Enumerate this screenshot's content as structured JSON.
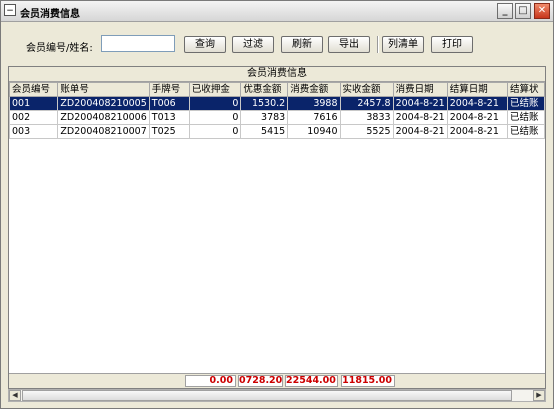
{
  "window": {
    "title": "会员消费信息",
    "system_icon": "−",
    "minimize": "_",
    "maximize": "□",
    "close": "✕"
  },
  "toolbar": {
    "search_label": "会员编号/姓名:",
    "search_value": "",
    "buttons": [
      "查询",
      "过滤",
      "刷新",
      "导出",
      "列清单",
      "打印"
    ]
  },
  "grid": {
    "title": "会员消费信息",
    "columns": [
      "会员编号",
      "账单号",
      "手牌号",
      "已收押金",
      "优惠金额",
      "消费金额",
      "实收金额",
      "消费日期",
      "结算日期",
      "结算状"
    ],
    "rows": [
      [
        "001",
        "ZD200408210005",
        "T006",
        "0",
        "1530.2",
        "3988",
        "2457.8",
        "2004-8-21",
        "2004-8-21",
        "已结账"
      ],
      [
        "002",
        "ZD200408210006",
        "T013",
        "0",
        "3783",
        "7616",
        "3833",
        "2004-8-21",
        "2004-8-21",
        "已结账"
      ],
      [
        "003",
        "ZD200408210007",
        "T025",
        "0",
        "5415",
        "10940",
        "5525",
        "2004-8-21",
        "2004-8-21",
        "已结账"
      ]
    ],
    "selected_row": 0,
    "totals": [
      "0.00",
      "0728.20",
      "22544.00",
      "11815.00"
    ]
  },
  "scrollbar": {
    "left_arrow": "◀",
    "right_arrow": "▶"
  },
  "colors": {
    "selection": "#0a246a",
    "totals_text": "#cc0000"
  }
}
